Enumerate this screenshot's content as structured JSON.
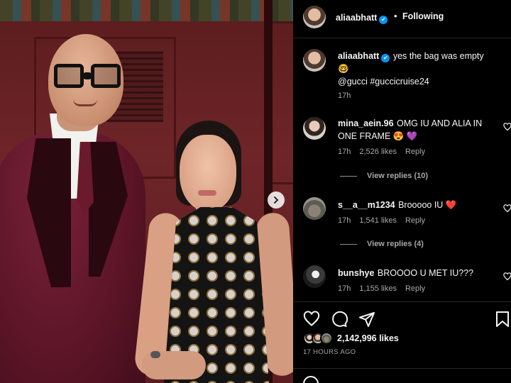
{
  "post": {
    "author": "aliaabhatt",
    "follow_state": "Following",
    "dot": "•",
    "verified_mark": "✔",
    "caption_text": "yes the bag was empty",
    "caption_emoji": "🤓",
    "caption_tags": "@gucci #guccicruise24",
    "caption_time": "17h",
    "likes": "2,142,996 likes",
    "posted_ago": "17 HOURS AGO"
  },
  "comments": [
    {
      "user": "mina_aein.96",
      "text": "OMG IU AND ALIA IN ONE FRAME 😍 💜",
      "time": "17h",
      "likes": "2,526 likes",
      "reply": "Reply",
      "view_replies": "View replies (10)"
    },
    {
      "user": "s__a__m1234",
      "text": "Brooooo IU ❤️",
      "time": "17h",
      "likes": "1,541 likes",
      "reply": "Reply",
      "view_replies": "View replies (4)"
    },
    {
      "user": "bunshye",
      "text": "BROOOO U MET IU???",
      "time": "17h",
      "likes": "1,155 likes",
      "reply": "Reply"
    }
  ],
  "icons": {
    "carousel_next": "chevron-right-icon",
    "like": "heart-icon",
    "comment": "comment-icon",
    "share": "send-icon",
    "save": "bookmark-icon",
    "comment_like": "heart-icon",
    "emoji": "emoji-icon"
  },
  "colors": {
    "background": "#000000",
    "text": "#f5f5f5",
    "muted": "#a8a8a8",
    "verified": "#0095f6",
    "photo_backdrop": "#6e2528"
  }
}
